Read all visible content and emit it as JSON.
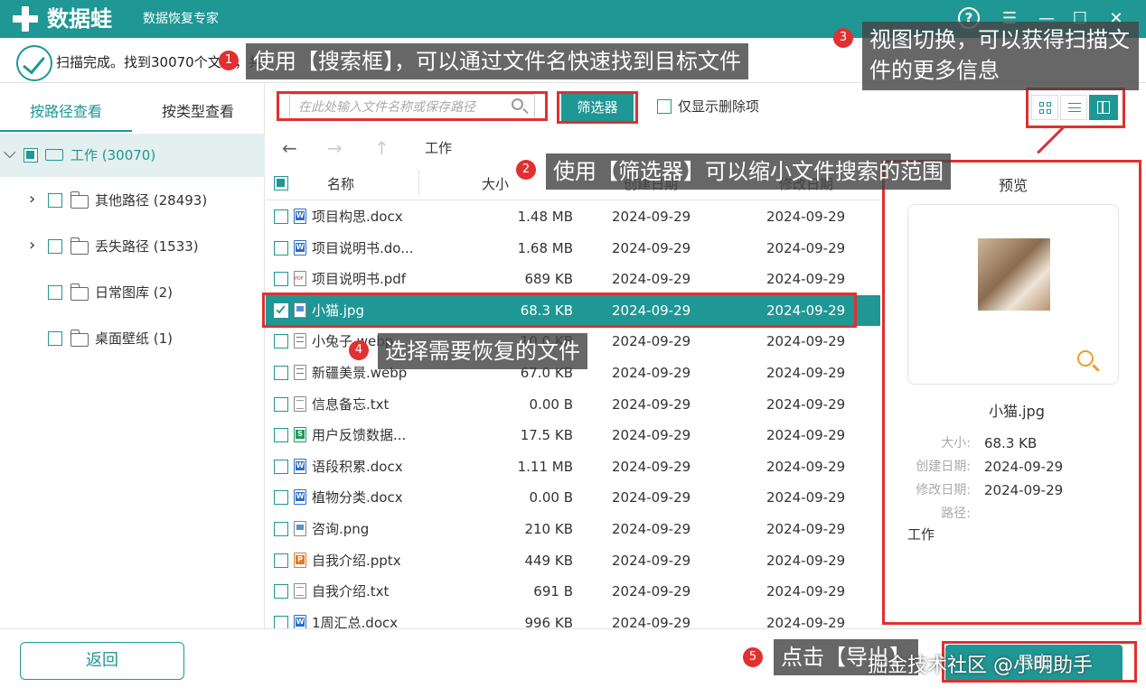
{
  "app": {
    "name": "数据蛙",
    "subtitle": "数据恢复专家"
  },
  "window_buttons": {
    "help": "?",
    "menu": "☰",
    "minimize": "—",
    "maximize": "☐",
    "close": "✕"
  },
  "status": {
    "text": "扫描完成。找到30070个文件，共"
  },
  "sidebar": {
    "tabs": [
      "按路径查看",
      "按类型查看"
    ],
    "tree": [
      {
        "label": "工作 (30070)"
      },
      {
        "label": "其他路径 (28493)"
      },
      {
        "label": "丢失路径 (1533)"
      },
      {
        "label": "日常图库 (2)"
      },
      {
        "label": "桌面壁纸 (1)"
      }
    ]
  },
  "toolbar": {
    "search_placeholder": "在此处输入文件名称或保存路径",
    "filter_label": "筛选器",
    "deleted_only_label": "仅显示删除项"
  },
  "pathbar": {
    "back": "←",
    "forward": "→",
    "up": "↑",
    "current": "工作"
  },
  "table": {
    "headers": [
      "名称",
      "大小",
      "创建日期",
      "修改日期"
    ],
    "rows": [
      {
        "name": "项目构思.docx",
        "size": "1.48 MB",
        "created": "2024-09-29",
        "modified": "2024-09-29",
        "icon": "word-file-icon"
      },
      {
        "name": "项目说明书.do...",
        "size": "1.68 MB",
        "created": "2024-09-29",
        "modified": "2024-09-29",
        "icon": "word-file-icon"
      },
      {
        "name": "项目说明书.pdf",
        "size": "689 KB",
        "created": "2024-09-29",
        "modified": "2024-09-29",
        "icon": "pdf-file-icon"
      },
      {
        "name": "小猫.jpg",
        "size": "68.3 KB",
        "created": "2024-09-29",
        "modified": "2024-09-29",
        "icon": "image-file-icon",
        "selected": true
      },
      {
        "name": "小兔子.webp",
        "size": "10.0 KB",
        "created": "2024-09-29",
        "modified": "2024-09-29",
        "icon": "webp-file-icon"
      },
      {
        "name": "新疆美景.webp",
        "size": "67.0 KB",
        "created": "2024-09-29",
        "modified": "2024-09-29",
        "icon": "webp-file-icon"
      },
      {
        "name": "信息备忘.txt",
        "size": "0.00  B",
        "created": "2024-09-29",
        "modified": "2024-09-29",
        "icon": "txt-file-icon"
      },
      {
        "name": "用户反馈数据...",
        "size": "17.5 KB",
        "created": "2024-09-29",
        "modified": "2024-09-29",
        "icon": "sheet-file-icon"
      },
      {
        "name": "语段积累.docx",
        "size": "1.11 MB",
        "created": "2024-09-29",
        "modified": "2024-09-29",
        "icon": "word-file-icon"
      },
      {
        "name": "植物分类.docx",
        "size": "0.00  B",
        "created": "2024-09-29",
        "modified": "2024-09-29",
        "icon": "word-file-icon"
      },
      {
        "name": "咨询.png",
        "size": "210 KB",
        "created": "2024-09-29",
        "modified": "2024-09-29",
        "icon": "image-file-icon"
      },
      {
        "name": "自我介绍.pptx",
        "size": "449 KB",
        "created": "2024-09-29",
        "modified": "2024-09-29",
        "icon": "ppt-file-icon"
      },
      {
        "name": "自我介绍.txt",
        "size": "691  B",
        "created": "2024-09-29",
        "modified": "2024-09-29",
        "icon": "txt-file-icon"
      },
      {
        "name": "1周汇总.docx",
        "size": "996 KB",
        "created": "2024-09-29",
        "modified": "2024-09-29",
        "icon": "word-file-icon"
      }
    ]
  },
  "preview": {
    "title": "预览",
    "file_name": "小猫.jpg",
    "size_key": "大小:",
    "size_val": "68.3 KB",
    "created_key": "创建日期:",
    "created_val": "2024-09-29",
    "modified_key": "修改日期:",
    "modified_val": "2024-09-29",
    "path_key": "路径:",
    "path_val": "工作"
  },
  "bottom": {
    "back_label": "返回",
    "export_label": "导出"
  },
  "annotations": [
    {
      "num": "1",
      "text": "使用【搜索框】，可以通过文件名快速找到目标文件"
    },
    {
      "num": "2",
      "text": "使用【筛选器】可以缩小文件搜索的范围"
    },
    {
      "num": "3",
      "text": "视图切换，可以获得扫描文件的更多信息"
    },
    {
      "num": "4",
      "text": "选择需要恢复的文件"
    },
    {
      "num": "5",
      "text": "点击【导出】"
    }
  ],
  "watermark": "掘金技术社区 @小明助手",
  "colors": {
    "accent": "#1f9794",
    "annotation_red": "#e03030"
  }
}
